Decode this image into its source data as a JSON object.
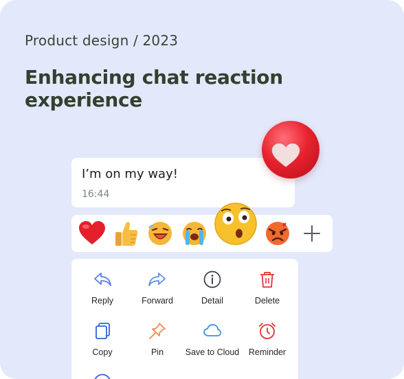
{
  "header": {
    "subtitle": "Product design / 2023",
    "title": "Enhancing chat reaction experience"
  },
  "message": {
    "text": "I’m on my way!",
    "time": "16:44"
  },
  "reactions": {
    "items": [
      "red-heart",
      "thumbs-up",
      "laughing-face",
      "loudly-crying-face",
      "astonished-face",
      "angry-face"
    ],
    "add_icon": "plus-icon",
    "highlighted": "astonished-face",
    "selected_reaction": "red-heart"
  },
  "menu": {
    "items": [
      {
        "label": "Reply",
        "icon": "reply-icon"
      },
      {
        "label": "Forward",
        "icon": "forward-icon"
      },
      {
        "label": "Detail",
        "icon": "info-icon"
      },
      {
        "label": "Delete",
        "icon": "trash-icon"
      },
      {
        "label": "Copy",
        "icon": "copy-icon"
      },
      {
        "label": "Pin",
        "icon": "pin-icon"
      },
      {
        "label": "Save to Cloud",
        "icon": "cloud-icon"
      },
      {
        "label": "Reminder",
        "icon": "alarm-clock-icon"
      }
    ]
  },
  "colors": {
    "background": "#e3e9fb",
    "title": "#33402f",
    "reply_forward": "#5b7ae6",
    "delete": "#e03232",
    "pin": "#f08a4b",
    "cloud": "#3d8fe0",
    "reminder": "#e03232",
    "copy": "#2b63d9"
  }
}
